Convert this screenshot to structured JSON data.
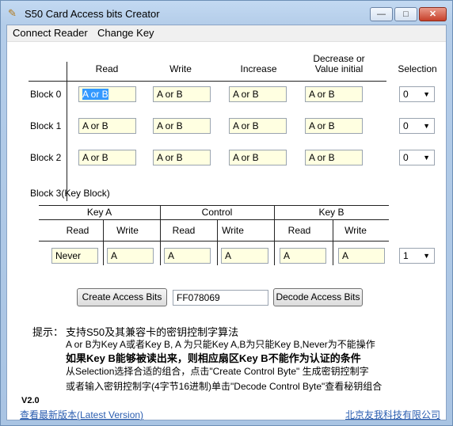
{
  "window": {
    "title": "S50 Card Access bits Creator",
    "controls": {
      "minimize": "—",
      "maximize": "□",
      "close": "✕"
    }
  },
  "menu": [
    "Connect Reader",
    "Change Key"
  ],
  "data_blocks": {
    "headers": [
      "Read",
      "Write",
      "Increase",
      "Decrease or\nValue initial",
      "Selection"
    ],
    "rows": [
      {
        "label": "Block 0",
        "values": [
          "A or B",
          "A or B",
          "A or B",
          "A or B"
        ],
        "selection": "0"
      },
      {
        "label": "Block 1",
        "values": [
          "A or B",
          "A or B",
          "A or B",
          "A or B"
        ],
        "selection": "0"
      },
      {
        "label": "Block 2",
        "values": [
          "A or B",
          "A or B",
          "A or B",
          "A or B"
        ],
        "selection": "0"
      }
    ]
  },
  "key_block": {
    "title": "Block 3(Key Block)",
    "groups": [
      "Key A",
      "Control",
      "Key B"
    ],
    "subheaders": [
      "Read",
      "Write",
      "Read",
      "Write",
      "Read",
      "Write"
    ],
    "values": [
      "Never",
      "A",
      "A",
      "A",
      "A",
      "A"
    ],
    "selection": "1"
  },
  "actions": {
    "create_label": "Create Access Bits",
    "access_bits_value": "FF078069",
    "decode_label": "Decode Access Bits"
  },
  "tips": {
    "prefix": "提示：",
    "line1": "支持S50及其兼容卡的密钥控制字算法",
    "line2": "A or B为Key A或者Key B, A 为只能Key A,B为只能Key B,Never为不能操作",
    "line3": "如果Key B能够被读出来，则相应扇区Key B不能作为认证的条件",
    "line4": "从Selection选择合适的组合，点击\"Create Control Byte\" 生成密钥控制字",
    "line5": "或者输入密钥控制字(4字节16进制)单击\"Decode Control Byte\"查看秘钥组合"
  },
  "footer": {
    "version": "V2.0",
    "latest_link": "查看最新版本(Latest Version)",
    "company_link": "北京友我科技有限公司"
  },
  "colors": {
    "field_bg": "#ffffe1",
    "link": "#2a5db0",
    "selection_highlight": "#3399ff"
  }
}
